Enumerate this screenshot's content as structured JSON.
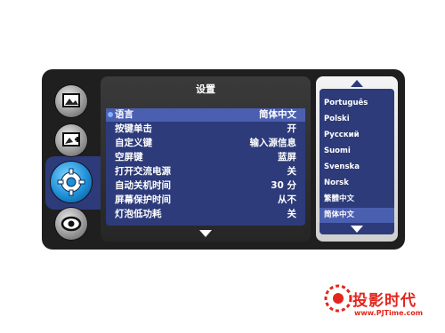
{
  "menu": {
    "title": "设置",
    "items": [
      {
        "label": "语言",
        "value": "简体中文"
      },
      {
        "label": "按键单击",
        "value": "开"
      },
      {
        "label": "自定义键",
        "value": "输入源信息"
      },
      {
        "label": "空屏键",
        "value": "蓝屏"
      },
      {
        "label": "打开交流电源",
        "value": "关"
      },
      {
        "label": "自动关机时间",
        "value": "30 分"
      },
      {
        "label": "屏幕保护时间",
        "value": "从不"
      },
      {
        "label": "灯泡低功耗",
        "value": "关"
      }
    ]
  },
  "languages": [
    "Português",
    "Polski",
    "Русский",
    "Suomi",
    "Svenska",
    "Norsk",
    "繁體中文",
    "简体中文"
  ],
  "selected_language": "简体中文",
  "sidebar_icons": [
    "picture-icon",
    "picture-plus-icon",
    "settings-gear-icon",
    "eye-icon"
  ],
  "watermark": {
    "name": "投影时代",
    "url": "www.PJTime.com"
  },
  "colors": {
    "accent": "#2d3b7a",
    "highlight": "#4b5fb0",
    "logo": "#e2261d"
  }
}
